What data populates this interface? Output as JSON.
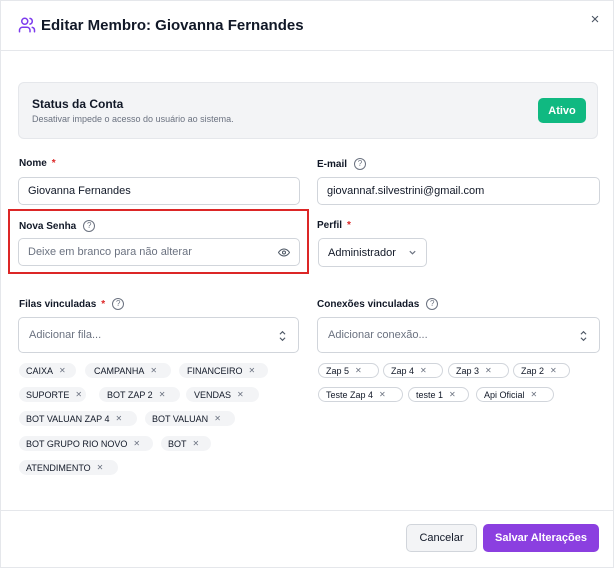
{
  "header": {
    "title": "Editar Membro:  Giovanna Fernandes",
    "close": "×"
  },
  "status": {
    "title": "Status da Conta",
    "description": "Desativar impede o acesso do usuário ao sistema.",
    "badge": "Ativo"
  },
  "fields": {
    "name": {
      "label": "Nome",
      "required": "*",
      "value": "Giovanna Fernandes"
    },
    "email": {
      "label": "E-mail",
      "value": "giovannaf.silvestrini@gmail.com"
    },
    "password": {
      "label": "Nova Senha",
      "placeholder": "Deixe em branco para não alterar"
    },
    "profile": {
      "label": "Perfil",
      "required": "*",
      "value": "Administrador"
    }
  },
  "queues": {
    "label": "Filas vinculadas",
    "required": "*",
    "placeholder": "Adicionar fila...",
    "tags": [
      "CAIXA",
      "CAMPANHA",
      "FINANCEIRO",
      "SUPORTE",
      "BOT ZAP 2",
      "VENDAS",
      "BOT VALUAN ZAP 4",
      "BOT VALUAN",
      "BOT GRUPO RIO NOVO",
      "BOT",
      "ATENDIMENTO"
    ]
  },
  "connections": {
    "label": "Conexões vinculadas",
    "placeholder": "Adicionar conexão...",
    "tags": [
      "Zap 5",
      "Zap 4",
      "Zap 3",
      "Zap 2",
      "Teste Zap 4",
      "teste 1",
      "Api Oficial"
    ]
  },
  "footer": {
    "cancel": "Cancelar",
    "save": "Salvar Alterações"
  },
  "icons": {
    "header": "users-icon",
    "help": "question-circle-icon",
    "password_toggle": "eye-icon",
    "remove": "close-icon"
  },
  "colors": {
    "active_badge": "#10b981",
    "primary": "#8b3fe0",
    "required": "#dc2626",
    "highlight": "#dc2626"
  }
}
